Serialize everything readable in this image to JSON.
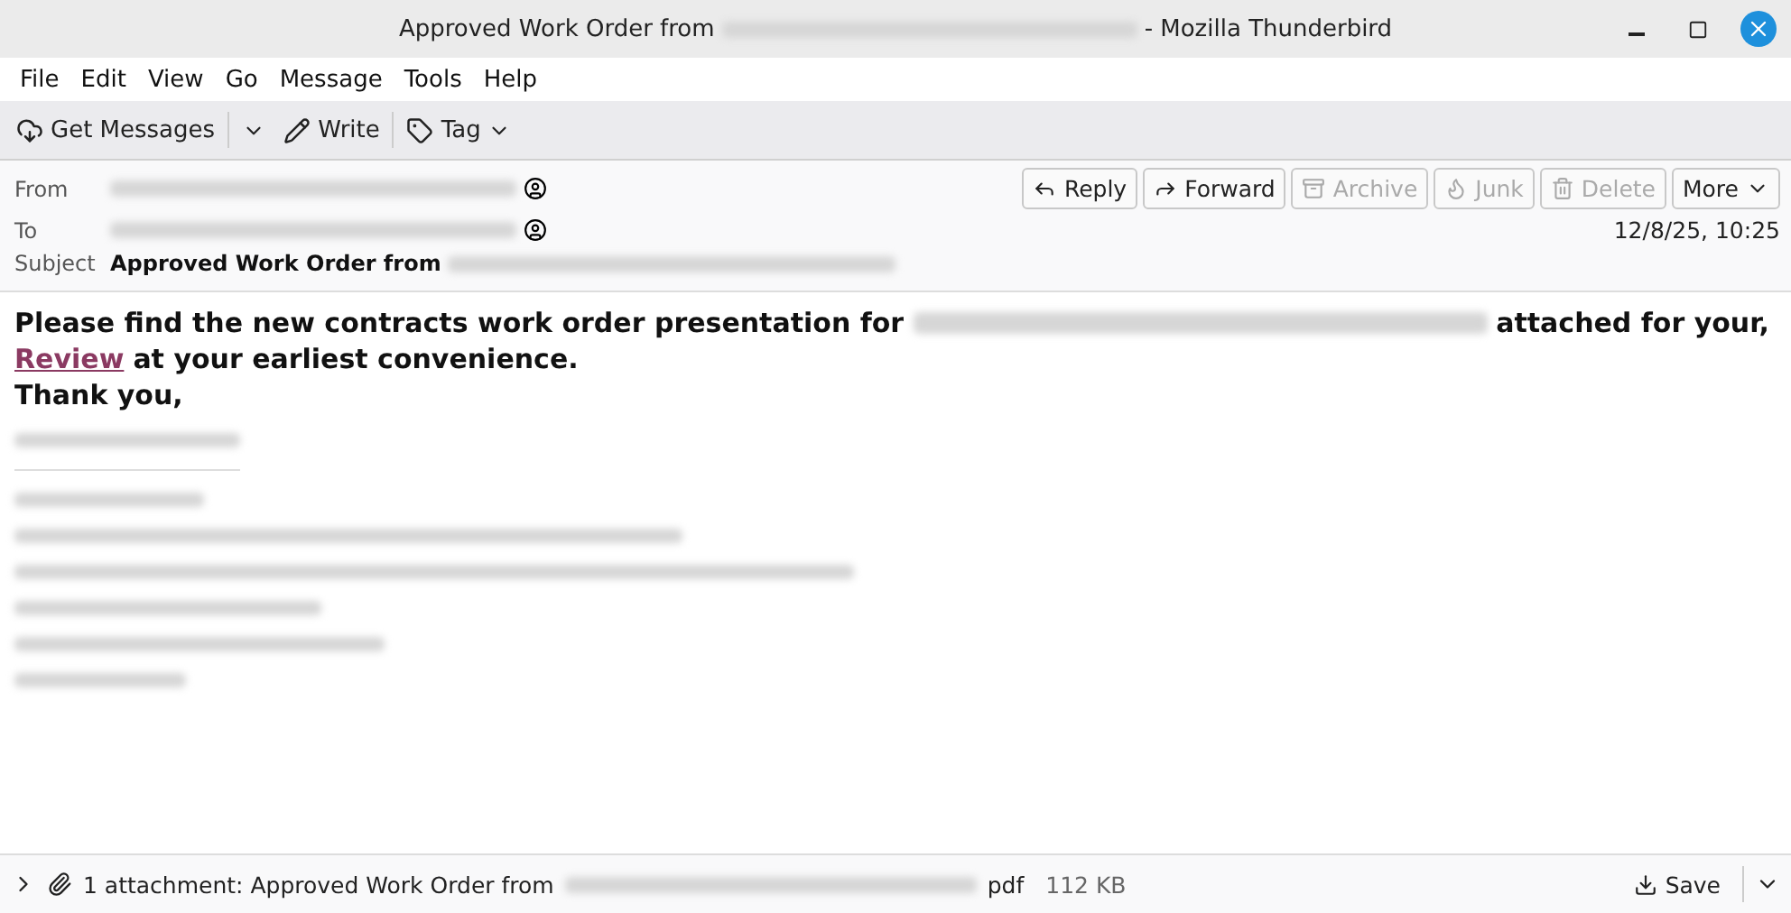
{
  "window": {
    "title_before": "Approved Work Order from",
    "title_after": "- Mozilla Thunderbird"
  },
  "menu": [
    {
      "label": "File"
    },
    {
      "label": "Edit"
    },
    {
      "label": "View"
    },
    {
      "label": "Go"
    },
    {
      "label": "Message"
    },
    {
      "label": "Tools"
    },
    {
      "label": "Help"
    }
  ],
  "toolbar": [
    {
      "kind": "get",
      "label": "Get Messages"
    },
    {
      "kind": "write",
      "label": "Write"
    },
    {
      "kind": "tag",
      "label": "Tag"
    }
  ],
  "header": {
    "from_label": "From",
    "to_label": "To",
    "subject_label": "Subject",
    "subject": "Approved Work Order from",
    "date": "12/8/25, 10:25",
    "actions": [
      {
        "kind": "reply",
        "label": "Reply",
        "disabled": false
      },
      {
        "kind": "forward",
        "label": "Forward",
        "disabled": false
      },
      {
        "kind": "archive",
        "label": "Archive",
        "disabled": true
      },
      {
        "kind": "junk",
        "label": "Junk",
        "disabled": true
      },
      {
        "kind": "delete",
        "label": "Delete",
        "disabled": true
      },
      {
        "kind": "more",
        "label": "More",
        "disabled": false
      }
    ]
  },
  "body": {
    "line1_before": "Please find the new contracts work order presentation for",
    "line1_after": "attached for your,",
    "link": "Review",
    "line2_after": "at your earliest convenience.",
    "line3": "Thank you,"
  },
  "attachment": {
    "label_before": "1 attachment: Approved Work Order from",
    "label_after": "pdf",
    "size": "112 KB",
    "save": "Save"
  }
}
